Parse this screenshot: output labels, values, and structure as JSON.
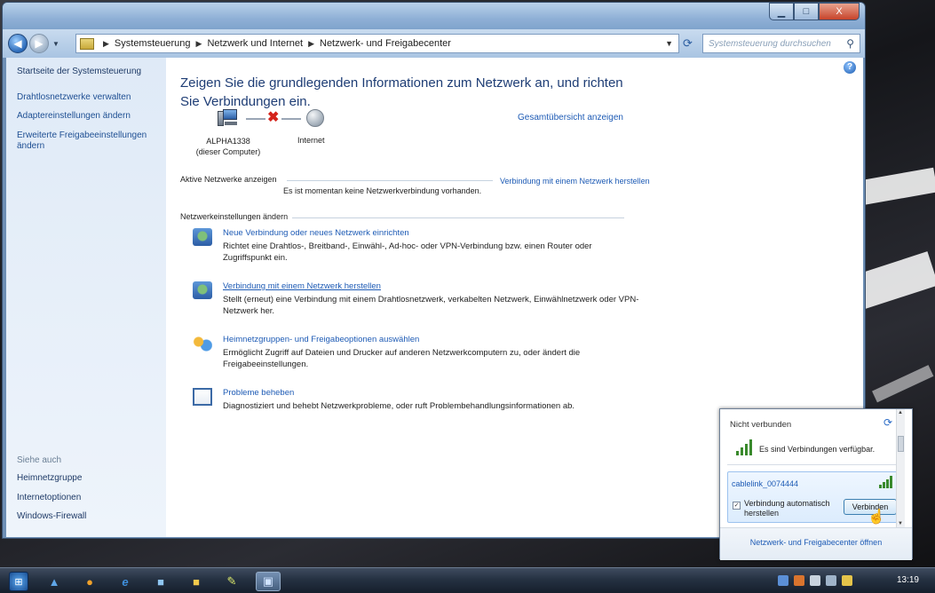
{
  "window": {
    "controls": {
      "minimize": "▁",
      "maximize": "□",
      "close": "X"
    }
  },
  "navbar": {
    "breadcrumb": [
      "Systemsteuerung",
      "Netzwerk und Internet",
      "Netzwerk- und Freigabecenter"
    ],
    "search_placeholder": "Systemsteuerung durchsuchen"
  },
  "sidebar": {
    "home": "Startseite der Systemsteuerung",
    "links": [
      "Drahtlosnetzwerke verwalten",
      "Adaptereinstellungen ändern",
      "Erweiterte Freigabeeinstellungen ändern"
    ],
    "see_also_title": "Siehe auch",
    "see_also": [
      "Heimnetzgruppe",
      "Internetoptionen",
      "Windows-Firewall"
    ]
  },
  "main": {
    "title": "Zeigen Sie die grundlegenden Informationen zum Netzwerk an, und richten Sie Verbindungen ein.",
    "overview_link": "Gesamtübersicht anzeigen",
    "computer_name": "ALPHA1338",
    "computer_sub": "(dieser Computer)",
    "internet_label": "Internet",
    "active_networks_label": "Aktive Netzwerke anzeigen",
    "active_networks_link": "Verbindung mit einem Netzwerk herstellen",
    "no_connection": "Es ist momentan keine Netzwerkverbindung vorhanden.",
    "settings_label": "Netzwerkeinstellungen ändern",
    "tasks": [
      {
        "title": "Neue Verbindung oder neues Netzwerk einrichten",
        "desc": "Richtet eine Drahtlos-, Breitband-, Einwähl-, Ad-hoc- oder VPN-Verbindung bzw. einen Router oder Zugriffspunkt ein.",
        "icon": "new-connection-icon"
      },
      {
        "title": "Verbindung mit einem Netzwerk herstellen",
        "desc": "Stellt (erneut) eine Verbindung mit einem Drahtlosnetzwerk, verkabelten Netzwerk, Einwählnetzwerk oder VPN-Netzwerk her.",
        "icon": "connect-network-icon"
      },
      {
        "title": "Heimnetzgruppen- und Freigabeoptionen auswählen",
        "desc": "Ermöglicht Zugriff auf Dateien und Drucker auf anderen Netzwerkcomputern zu, oder ändert die Freigabeeinstellungen.",
        "icon": "homegroup-icon"
      },
      {
        "title": "Probleme beheben",
        "desc": "Diagnostiziert und behebt Netzwerkprobleme, oder ruft Problembehandlungsinformationen ab.",
        "icon": "troubleshoot-icon"
      }
    ]
  },
  "flyout": {
    "status": "Nicht verbunden",
    "available": "Es sind Verbindungen verfügbar.",
    "network_name": "cablelink_0074444",
    "auto_connect_label": "Verbindung automatisch herstellen",
    "auto_connect_checked": true,
    "connect_button": "Verbinden",
    "center_link": "Netzwerk- und Freigabecenter öffnen"
  },
  "taskbar": {
    "clock": "13:19"
  },
  "colors": {
    "link": "#1e5bb5",
    "title": "#1e3d75",
    "error": "#d4231b",
    "signal": "#3a8a2d"
  }
}
